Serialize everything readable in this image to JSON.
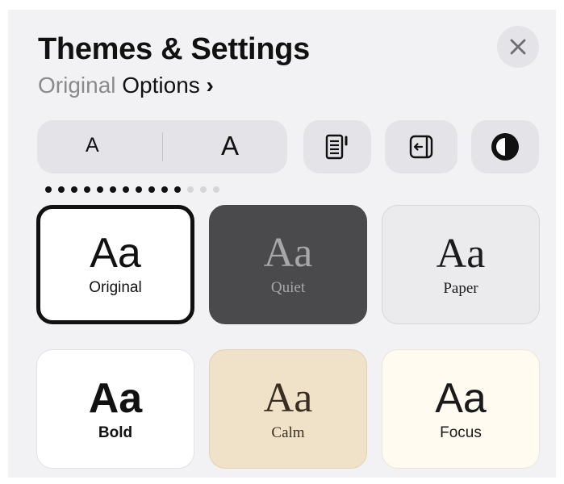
{
  "header": {
    "title": "Themes & Settings",
    "subtitle_theme": "Original",
    "subtitle_options": "Options",
    "subtitle_chevron": "›"
  },
  "toolbar": {
    "font_smaller_label": "A",
    "font_larger_label": "A",
    "icons": [
      "page-layout-icon",
      "sidebar-icon",
      "appearance-contrast-icon"
    ]
  },
  "page_indicator": {
    "total": 14,
    "active_through": 11
  },
  "themes": [
    {
      "label": "Aa",
      "name": "Original",
      "selected": true,
      "bg": "#ffffff",
      "fg": "#111111"
    },
    {
      "label": "Aa",
      "name": "Quiet",
      "selected": false,
      "bg": "#4a4a4c",
      "fg": "#a7a7aa"
    },
    {
      "label": "Aa",
      "name": "Paper",
      "selected": false,
      "bg": "#ebebed",
      "fg": "#1a1a1a"
    },
    {
      "label": "Aa",
      "name": "Bold",
      "selected": false,
      "bg": "#ffffff",
      "fg": "#111111"
    },
    {
      "label": "Aa",
      "name": "Calm",
      "selected": false,
      "bg": "#f0e2c8",
      "fg": "#3a2e22"
    },
    {
      "label": "Aa",
      "name": "Focus",
      "selected": false,
      "bg": "#fffbf1",
      "fg": "#1a1a1a"
    }
  ]
}
